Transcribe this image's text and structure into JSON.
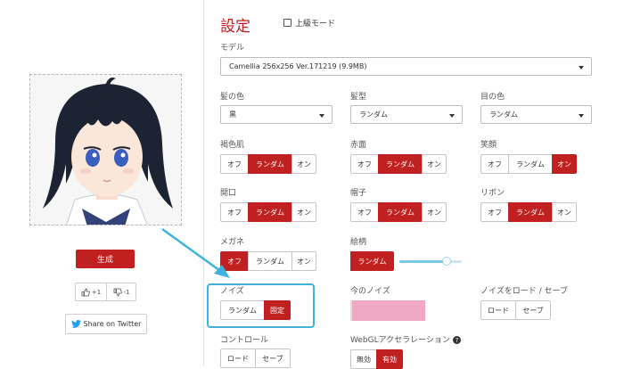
{
  "settings": {
    "title": "設定",
    "advanced_mode_label": "上級モード"
  },
  "model": {
    "label": "モデル",
    "selected": "Camellia 256x256 Ver.171219 (9.9MB)"
  },
  "hair_color": {
    "label": "髪の色",
    "selected": "黒"
  },
  "hair_style": {
    "label": "髪型",
    "selected": "ランダム"
  },
  "eye_color": {
    "label": "目の色",
    "selected": "ランダム"
  },
  "tan_skin": {
    "label": "褐色肌",
    "options": [
      "オフ",
      "ランダム",
      "オン"
    ],
    "selected_index": 1
  },
  "blush": {
    "label": "赤面",
    "options": [
      "オフ",
      "ランダム",
      "オン"
    ],
    "selected_index": 1
  },
  "smile": {
    "label": "笑顔",
    "options": [
      "オフ",
      "ランダム",
      "オン"
    ],
    "selected_index": 2
  },
  "open_mouth": {
    "label": "開口",
    "options": [
      "オフ",
      "ランダム",
      "オン"
    ],
    "selected_index": 1
  },
  "hat": {
    "label": "帽子",
    "options": [
      "オフ",
      "ランダム",
      "オン"
    ],
    "selected_index": 1
  },
  "ribbon": {
    "label": "リボン",
    "options": [
      "オフ",
      "ランダム",
      "オン"
    ],
    "selected_index": 1
  },
  "glasses": {
    "label": "メガネ",
    "options": [
      "オフ",
      "ランダム",
      "オン"
    ],
    "selected_index": 0
  },
  "art_style": {
    "label": "絵柄",
    "option": "ランダム",
    "slider_fraction": 0.75
  },
  "noise": {
    "label": "ノイズ",
    "options": [
      "ランダム",
      "固定"
    ],
    "selected_index": 1
  },
  "current_noise": {
    "label": "今のノイズ"
  },
  "noise_load_save": {
    "label": "ノイズをロード / セーブ",
    "options": [
      "ロード",
      "セーブ"
    ]
  },
  "control": {
    "label": "コントロール",
    "options": [
      "ロード",
      "セーブ"
    ]
  },
  "webgl": {
    "label": "WebGLアクセラレーション",
    "help_glyph": "?",
    "options": [
      "無効",
      "有効"
    ],
    "selected_index": 1
  },
  "actions": {
    "generate": "生成",
    "upvote": "+1",
    "downvote": "-1",
    "share": "Share on Twitter"
  },
  "icons": {
    "thumbs_up": "thumbs-up-icon",
    "thumbs_down": "thumbs-down-icon",
    "twitter": "twitter-bird-icon",
    "arrow": "pointer-arrow",
    "help": "question-circle-icon"
  },
  "colors": {
    "accent": "#c0201f",
    "highlight": "#3fb3dd",
    "twitter": "#1da1f2"
  }
}
